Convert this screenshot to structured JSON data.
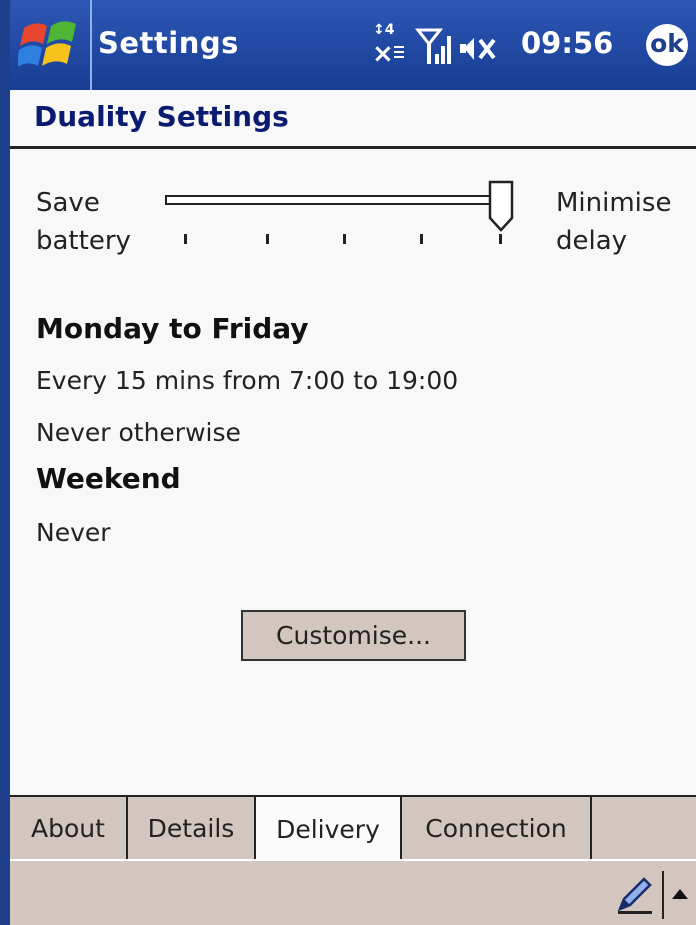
{
  "titlebar": {
    "title": "Settings",
    "time": "09:56",
    "ok_label": "ok",
    "icons": [
      "windows-start-icon",
      "connectivity-icon",
      "signal-icon",
      "volume-muted-icon"
    ]
  },
  "page": {
    "title": "Duality Settings"
  },
  "slider": {
    "left_label_line1": "Save",
    "left_label_line2": "battery",
    "right_label_line1": "Minimise",
    "right_label_line2": "delay",
    "ticks": 5,
    "position": 5
  },
  "schedule": {
    "weekday_heading": "Monday to Friday",
    "weekday_rule": "Every 15 mins from 7:00  to 19:00",
    "weekday_otherwise": "Never otherwise",
    "weekend_heading": "Weekend",
    "weekend_rule": "Never"
  },
  "customise_label": "Customise...",
  "tabs": [
    {
      "label": "About",
      "active": false
    },
    {
      "label": "Details",
      "active": false
    },
    {
      "label": "Delivery",
      "active": true
    },
    {
      "label": "Connection",
      "active": false
    }
  ],
  "colors": {
    "titlebar": "#183d93",
    "background": "#f8f8f8",
    "chrome": "#d2c6be",
    "heading": "#0a1c6f"
  }
}
